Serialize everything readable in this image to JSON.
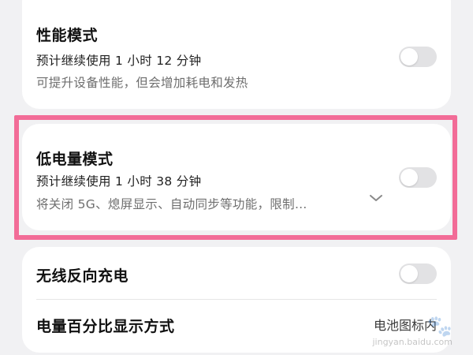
{
  "performance_mode": {
    "title": "性能模式",
    "estimate": "预计继续使用 1 小时 12 分钟",
    "description": "可提升设备性能，但会增加耗电和发热",
    "enabled": false
  },
  "low_power_mode": {
    "title": "低电量模式",
    "estimate": "预计继续使用 1 小时 38 分钟",
    "description": "将关闭 5G、熄屏显示、自动同步等功能，限制…",
    "enabled": false,
    "expand_icon": "chevron-down-icon"
  },
  "wireless_reverse_charging": {
    "title": "无线反向充电",
    "enabled": false
  },
  "battery_percentage_display": {
    "title": "电量百分比显示方式",
    "value": "电池图标内"
  },
  "watermark": {
    "text": "jingyan.baidu.com",
    "icon": "paw-icon"
  },
  "colors": {
    "background": "#f1f1f3",
    "card": "#ffffff",
    "highlight": "#f26c97",
    "toggle_off": "#e2e2e4"
  }
}
